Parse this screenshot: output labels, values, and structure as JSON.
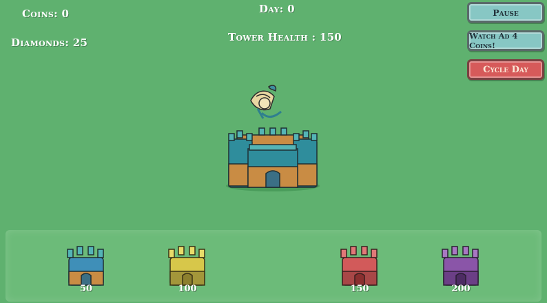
{
  "hud": {
    "coins": "Coins: 0",
    "diamonds": "Diamonds: 25",
    "day": "Day: 0",
    "tower_health": "Tower Health : 150"
  },
  "buttons": {
    "pause": "Pause",
    "watch_ad": "Watch Ad 4 Coins!",
    "cycle_day": "Cycle Day"
  },
  "shop": {
    "items": [
      {
        "price": "50",
        "color": "#3f8fb8"
      },
      {
        "price": "100",
        "color": "#d7c74a"
      },
      {
        "price": "150",
        "color": "#d25a5a"
      },
      {
        "price": "200",
        "color": "#8a55a8"
      }
    ]
  },
  "colors": {
    "background": "#5fb16f",
    "main_tower_stone": "#2f8d9c",
    "main_tower_wood": "#c98c44"
  }
}
